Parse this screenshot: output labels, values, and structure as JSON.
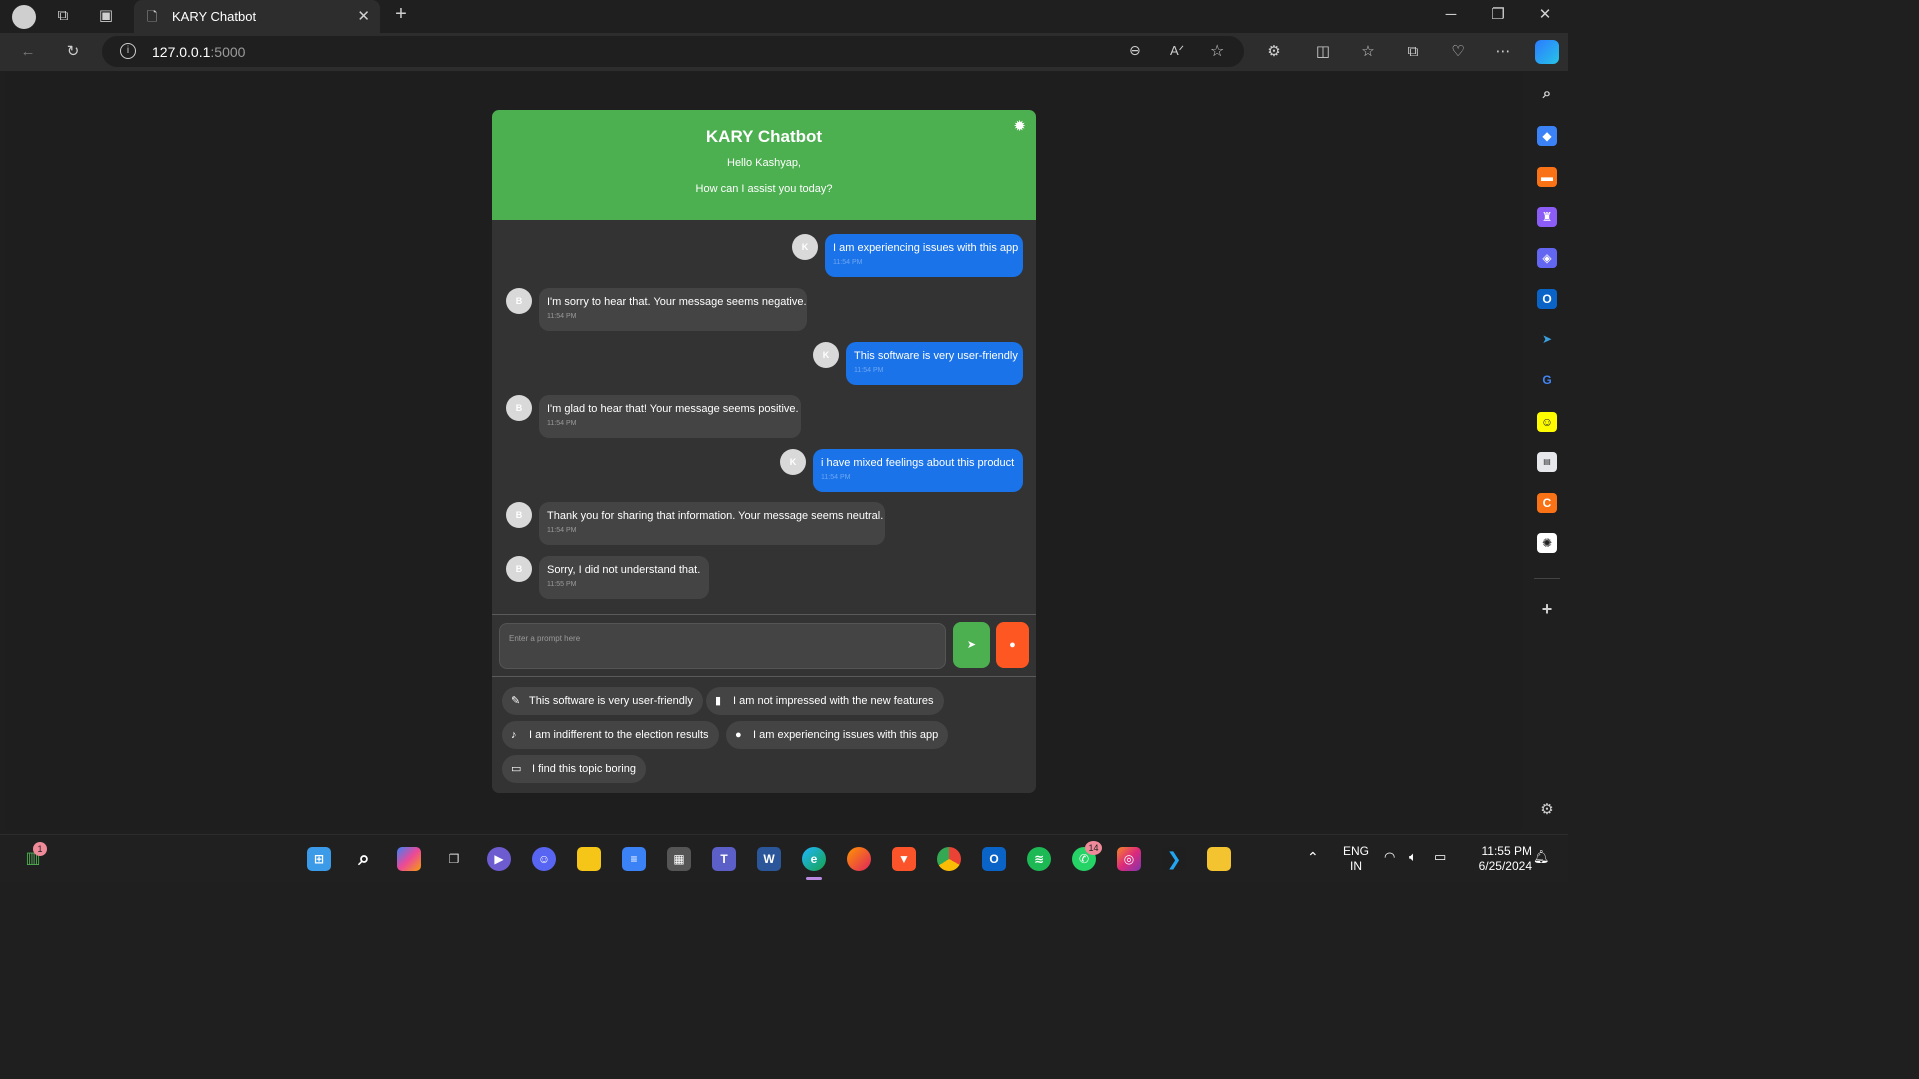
{
  "browser": {
    "tab_title": "KARY Chatbot",
    "address_host": "127.0.0.1",
    "address_port": ":5000"
  },
  "chat": {
    "title": "KARY Chatbot",
    "greeting": "Hello Kashyap,",
    "subgreeting": "How can I assist you today?",
    "messages": [
      {
        "sender": "user",
        "avatar": "K",
        "text": "I am experiencing issues with this app",
        "time": "11:54 PM"
      },
      {
        "sender": "bot",
        "avatar": "B",
        "text": "I'm sorry to hear that. Your message seems negative.",
        "time": "11:54 PM"
      },
      {
        "sender": "user",
        "avatar": "K",
        "text": "This software is very user-friendly",
        "time": "11:54 PM"
      },
      {
        "sender": "bot",
        "avatar": "B",
        "text": "I'm glad to hear that! Your message seems positive.",
        "time": "11:54 PM"
      },
      {
        "sender": "user",
        "avatar": "K",
        "text": "i have mixed feelings about this product",
        "time": "11:54 PM"
      },
      {
        "sender": "bot",
        "avatar": "B",
        "text": "Thank you for sharing that information. Your message seems neutral.",
        "time": "11:54 PM"
      },
      {
        "sender": "bot",
        "avatar": "B",
        "text": "Sorry, I did not understand that.",
        "time": "11:55 PM"
      }
    ],
    "prompt_placeholder": "Enter a prompt here",
    "suggestions": [
      {
        "icon": "pencil-icon",
        "text": "This software is very user-friendly"
      },
      {
        "icon": "book-icon",
        "text": "I am not impressed with the new features"
      },
      {
        "icon": "guitar-icon",
        "text": "I am indifferent to the election results"
      },
      {
        "icon": "user-circle-icon",
        "text": "I am experiencing issues with this app"
      },
      {
        "icon": "laptop-icon",
        "text": "I find this topic boring"
      }
    ],
    "colors": {
      "header": "#4caf50",
      "user_bubble": "#1a73e8",
      "send": "#4caf50",
      "mic": "#ff5722"
    }
  },
  "taskbar": {
    "language_line1": "ENG",
    "language_line2": "IN",
    "time": "11:55 PM",
    "date": "6/25/2024",
    "whatsapp_badge": "14",
    "widget_badge": "1"
  }
}
